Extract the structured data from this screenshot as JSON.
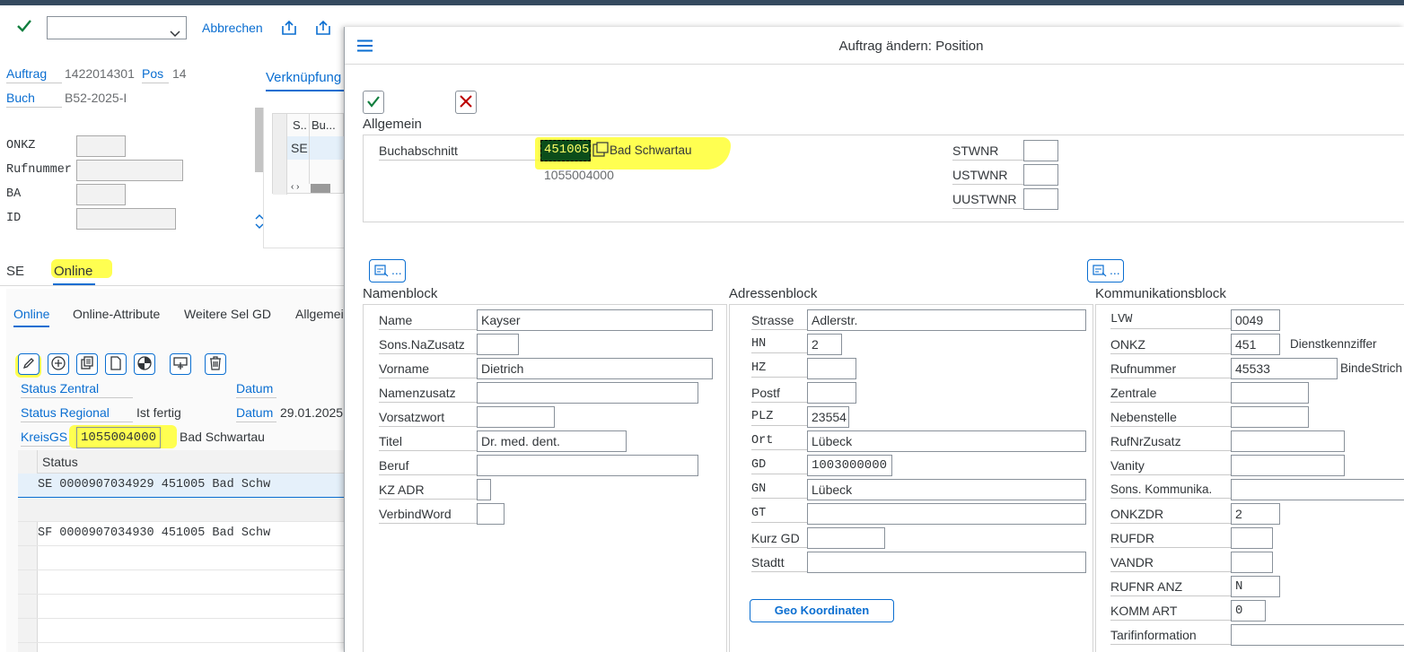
{
  "toolbar": {
    "check_icon": "checkmark-icon",
    "dropdown_value": "",
    "cancel_label": "Abbrechen"
  },
  "left": {
    "auftrag_label": "Auftrag",
    "auftrag_value": "1422014301",
    "pos_label": "Pos",
    "pos_value": "14",
    "buch_label": "Buch",
    "buch_value": "B52-2025-I",
    "verknuepfung_label": "Verknüpfung",
    "onkz_label": "ONKZ",
    "rufnummer_label": "Rufnummer",
    "ba_label": "BA",
    "id_label": "ID",
    "mini_table": {
      "col1": "S..",
      "col2": "Bu...",
      "row1": "SE"
    },
    "tabs": [
      "SE",
      "Online"
    ],
    "subtabs": [
      "Online",
      "Online-Attribute",
      "Weitere Sel GD",
      "Allgemei"
    ],
    "status_zentral_label": "Status Zentral",
    "datum_label_1": "Datum",
    "status_regional_label": "Status Regional",
    "status_regional_value": "Ist fertig",
    "datum_label_2": "Datum",
    "datum_value_2": "29.01.2025",
    "kreisgs_label": "KreisGS",
    "kreisgs_value": "1055004000",
    "kreisgs_name": "Bad Schwartau",
    "grid_header": "Status",
    "grid_rows": [
      "SE 0000907034929 451005 Bad Schw",
      "",
      "SF 0000907034930 451005 Bad Schw"
    ]
  },
  "dialog": {
    "title": "Auftrag ändern: Position",
    "allgemein": {
      "heading": "Allgemein",
      "buchabschnitt_label": "Buchabschnitt",
      "buchabschnitt_value": "451005",
      "buchabschnitt_name": "Bad Schwartau",
      "buchabschnitt_sub": "1055004000",
      "stwnr_label": "STWNR",
      "ustwnr_label": "USTWNR",
      "uustwnr_label": "UUSTWNR"
    },
    "namenblock": {
      "heading": "Namenblock",
      "fields": [
        {
          "label": "Name",
          "value": "Kayser"
        },
        {
          "label": "Sons.NaZusatz",
          "value": ""
        },
        {
          "label": "Vorname",
          "value": "Dietrich"
        },
        {
          "label": "Namenzusatz",
          "value": ""
        },
        {
          "label": "Vorsatzwort",
          "value": ""
        },
        {
          "label": "Titel",
          "value": "Dr. med. dent."
        },
        {
          "label": "Beruf",
          "value": ""
        },
        {
          "label": "KZ ADR",
          "value": ""
        },
        {
          "label": "VerbindWord",
          "value": ""
        }
      ]
    },
    "adressenblock": {
      "heading": "Adressenblock",
      "fields": [
        {
          "label": "Strasse",
          "value": "Adlerstr."
        },
        {
          "label": "HN",
          "value": "2"
        },
        {
          "label": "HZ",
          "value": ""
        },
        {
          "label": "Postf",
          "value": ""
        },
        {
          "label": "PLZ",
          "value": "23554"
        },
        {
          "label": "Ort",
          "value": "Lübeck"
        },
        {
          "label": "GD",
          "value": "1003000000"
        },
        {
          "label": "GN",
          "value": "Lübeck"
        },
        {
          "label": "GT",
          "value": ""
        },
        {
          "label": "Kurz GD",
          "value": ""
        },
        {
          "label": "Stadtt",
          "value": ""
        }
      ],
      "geo_button": "Geo Koordinaten"
    },
    "kommunikationsblock": {
      "heading": "Kommunikationsblock",
      "fields": [
        {
          "label": "LVW",
          "value": "0049"
        },
        {
          "label": "ONKZ",
          "value": "451"
        },
        {
          "label": "Rufnummer",
          "value": "45533"
        },
        {
          "label": "Zentrale",
          "value": ""
        },
        {
          "label": "Nebenstelle",
          "value": ""
        },
        {
          "label": "RufNrZusatz",
          "value": ""
        },
        {
          "label": "Vanity",
          "value": ""
        },
        {
          "label": "Sons. Kommunika.",
          "value": ""
        },
        {
          "label": "ONKZDR",
          "value": "2"
        },
        {
          "label": "RUFDR",
          "value": ""
        },
        {
          "label": "VANDR",
          "value": ""
        },
        {
          "label": "RUFNR ANZ",
          "value": "N"
        },
        {
          "label": "KOMM ART",
          "value": "0"
        },
        {
          "label": "Tarifinformation",
          "value": ""
        }
      ],
      "dienstkennziffer_label": "Dienstkennziffer",
      "bindestrich_label": "BindeStrich"
    },
    "more_button_label": "..."
  },
  "colors": {
    "accent": "#0a6ed1",
    "highlight": "#ffff33",
    "shell": "#354a5f",
    "confirm_green": "#107e3e",
    "cancel_red": "#bb0000"
  }
}
